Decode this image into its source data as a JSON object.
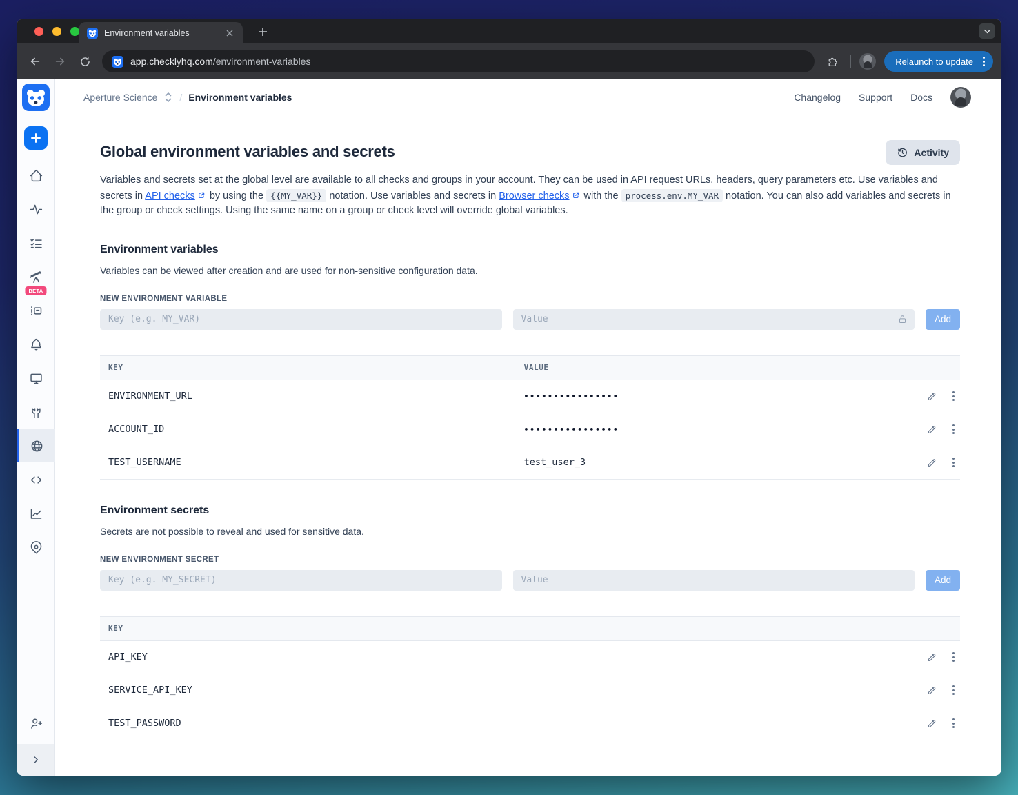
{
  "browser": {
    "tab_title": "Environment variables",
    "url_domain": "app.checklyhq.com",
    "url_path": "/environment-variables",
    "relaunch_label": "Relaunch to update"
  },
  "header": {
    "account_name": "Aperture Science",
    "breadcrumb_separator": "/",
    "page_name": "Environment variables",
    "nav_links": [
      "Changelog",
      "Support",
      "Docs"
    ]
  },
  "sidebar": {
    "beta_badge": "BETA"
  },
  "main": {
    "title": "Global environment variables and secrets",
    "activity_button": "Activity",
    "intro": {
      "part1": "Variables and secrets set at the global level are available to all checks and groups in your account. They can be used in API request URLs, headers, query parameters etc. Use variables and secrets in ",
      "link1": "API checks",
      "part2": " by using the ",
      "code1": "{{MY_VAR}}",
      "part3": " notation. Use variables and secrets in ",
      "link2": "Browser checks",
      "part4": " with the ",
      "code2": "process.env.MY_VAR",
      "part5": " notation. You can also add variables and secrets in the group or check settings. Using the same name on a group or check level will override global variables."
    },
    "variables_section": {
      "heading": "Environment variables",
      "description": "Variables can be viewed after creation and are used for non-sensitive configuration data.",
      "form_label": "NEW ENVIRONMENT VARIABLE",
      "key_placeholder": "Key (e.g. MY_VAR)",
      "value_placeholder": "Value",
      "add_label": "Add",
      "columns": {
        "key": "KEY",
        "value": "VALUE"
      },
      "rows": [
        {
          "key": "ENVIRONMENT_URL",
          "value": "••••••••••••••••",
          "masked": "true"
        },
        {
          "key": "ACCOUNT_ID",
          "value": "••••••••••••••••",
          "masked": "true"
        },
        {
          "key": "TEST_USERNAME",
          "value": "test_user_3",
          "masked": "false"
        }
      ]
    },
    "secrets_section": {
      "heading": "Environment secrets",
      "description": "Secrets are not possible to reveal and used for sensitive data.",
      "form_label": "NEW ENVIRONMENT SECRET",
      "key_placeholder": "Key (e.g. MY_SECRET)",
      "value_placeholder": "Value",
      "add_label": "Add",
      "columns": {
        "key": "KEY"
      },
      "rows": [
        {
          "key": "API_KEY"
        },
        {
          "key": "SERVICE_API_KEY"
        },
        {
          "key": "TEST_PASSWORD"
        }
      ]
    }
  },
  "colors": {
    "accent_blue": "#0b72f2",
    "link_blue": "#2563eb",
    "beta_pink": "#f2497c",
    "relaunch_blue": "#1a6dbb",
    "add_button_blue": "#82b1f0"
  }
}
